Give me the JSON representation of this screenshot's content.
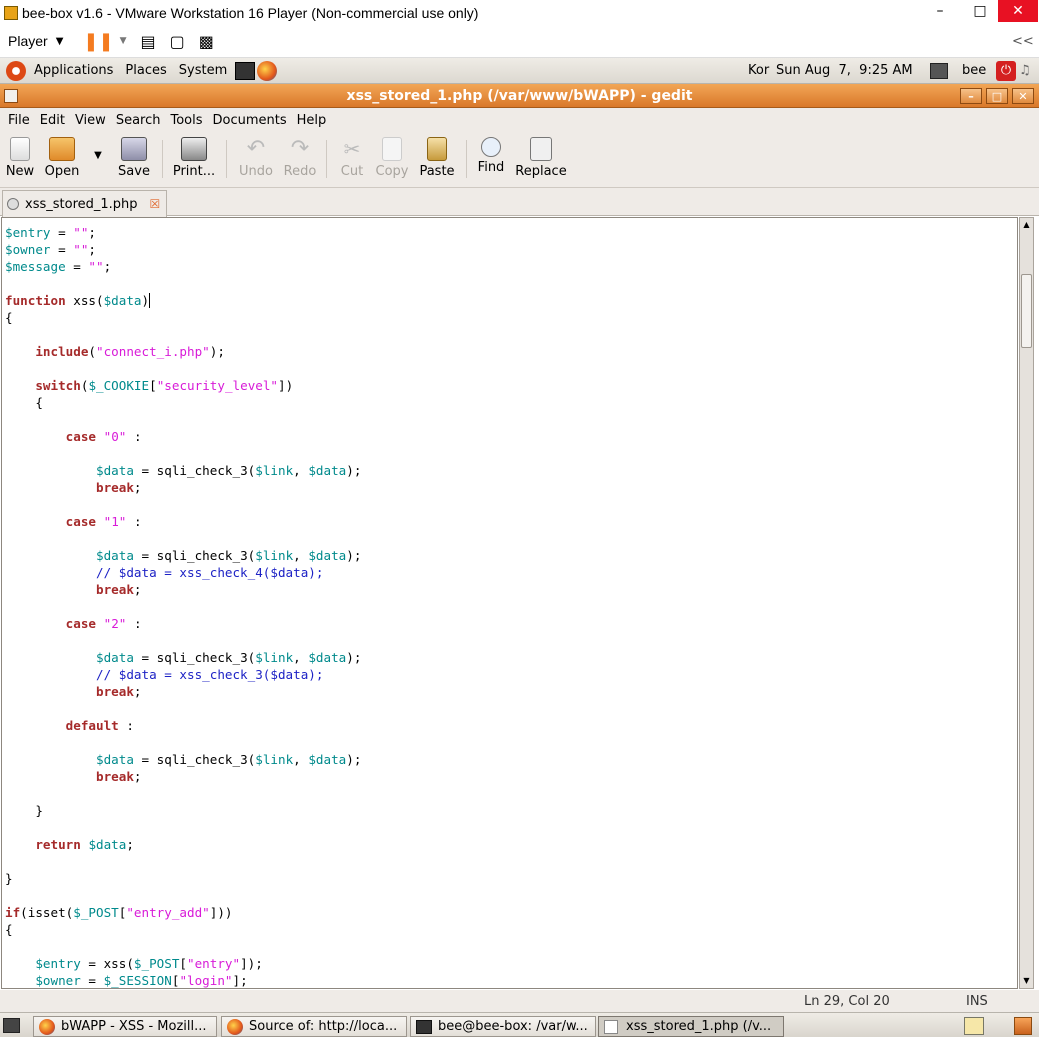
{
  "vm": {
    "title": "bee-box v1.6 - VMware Workstation 16 Player (Non-commercial use only)",
    "player_label": "Player",
    "restore_label": "<<"
  },
  "panel": {
    "applications": "Applications",
    "places": "Places",
    "system": "System",
    "keyboard": "Kor",
    "datetime": "Sun Aug  7,  9:25 AM",
    "user": "bee"
  },
  "gedit": {
    "title": "xss_stored_1.php (/var/www/bWAPP) - gedit",
    "menu": [
      "File",
      "Edit",
      "View",
      "Search",
      "Tools",
      "Documents",
      "Help"
    ],
    "toolbar": {
      "new": "New",
      "open": "Open",
      "save": "Save",
      "print": "Print...",
      "undo": "Undo",
      "redo": "Redo",
      "cut": "Cut",
      "copy": "Copy",
      "paste": "Paste",
      "find": "Find",
      "replace": "Replace"
    },
    "tab_label": "xss_stored_1.php",
    "status": {
      "position": "Ln 29, Col 20",
      "mode": "INS"
    }
  },
  "code_lines": [
    "$entry = \"\";",
    "$owner = \"\";",
    "$message = \"\";",
    "",
    "function xss($data)",
    "{",
    "",
    "    include(\"connect_i.php\");",
    "",
    "    switch($_COOKIE[\"security_level\"])",
    "    {",
    "",
    "        case \"0\" :",
    "",
    "            $data = sqli_check_3($link, $data);",
    "            break;",
    "",
    "        case \"1\" :",
    "",
    "            $data = sqli_check_3($link, $data);",
    "            // $data = xss_check_4($data);",
    "            break;",
    "",
    "        case \"2\" :",
    "",
    "            $data = sqli_check_3($link, $data);",
    "            // $data = xss_check_3($data);",
    "            break;",
    "",
    "        default :",
    "",
    "            $data = sqli_check_3($link, $data);",
    "            break;",
    "",
    "    }",
    "",
    "    return $data;",
    "",
    "}",
    "",
    "if(isset($_POST[\"entry_add\"]))",
    "{",
    "",
    "    $entry = xss($_POST[\"entry\"]);",
    "    $owner = $_SESSION[\"login\"];"
  ],
  "taskbar": [
    {
      "label": "bWAPP - XSS - Mozill...",
      "icon": "firefox-icon"
    },
    {
      "label": "Source of: http://loca...",
      "icon": "firefox-icon"
    },
    {
      "label": "bee@bee-box: /var/w...",
      "icon": "terminal-icon"
    },
    {
      "label": "xss_stored_1.php (/v...",
      "icon": "gedit-icon"
    }
  ],
  "colors": {
    "title_orange": "#e0873a",
    "variable": "#008a8c",
    "string": "#d81bd8",
    "keyword": "#a52a2a",
    "comment": "#1d22c5"
  }
}
